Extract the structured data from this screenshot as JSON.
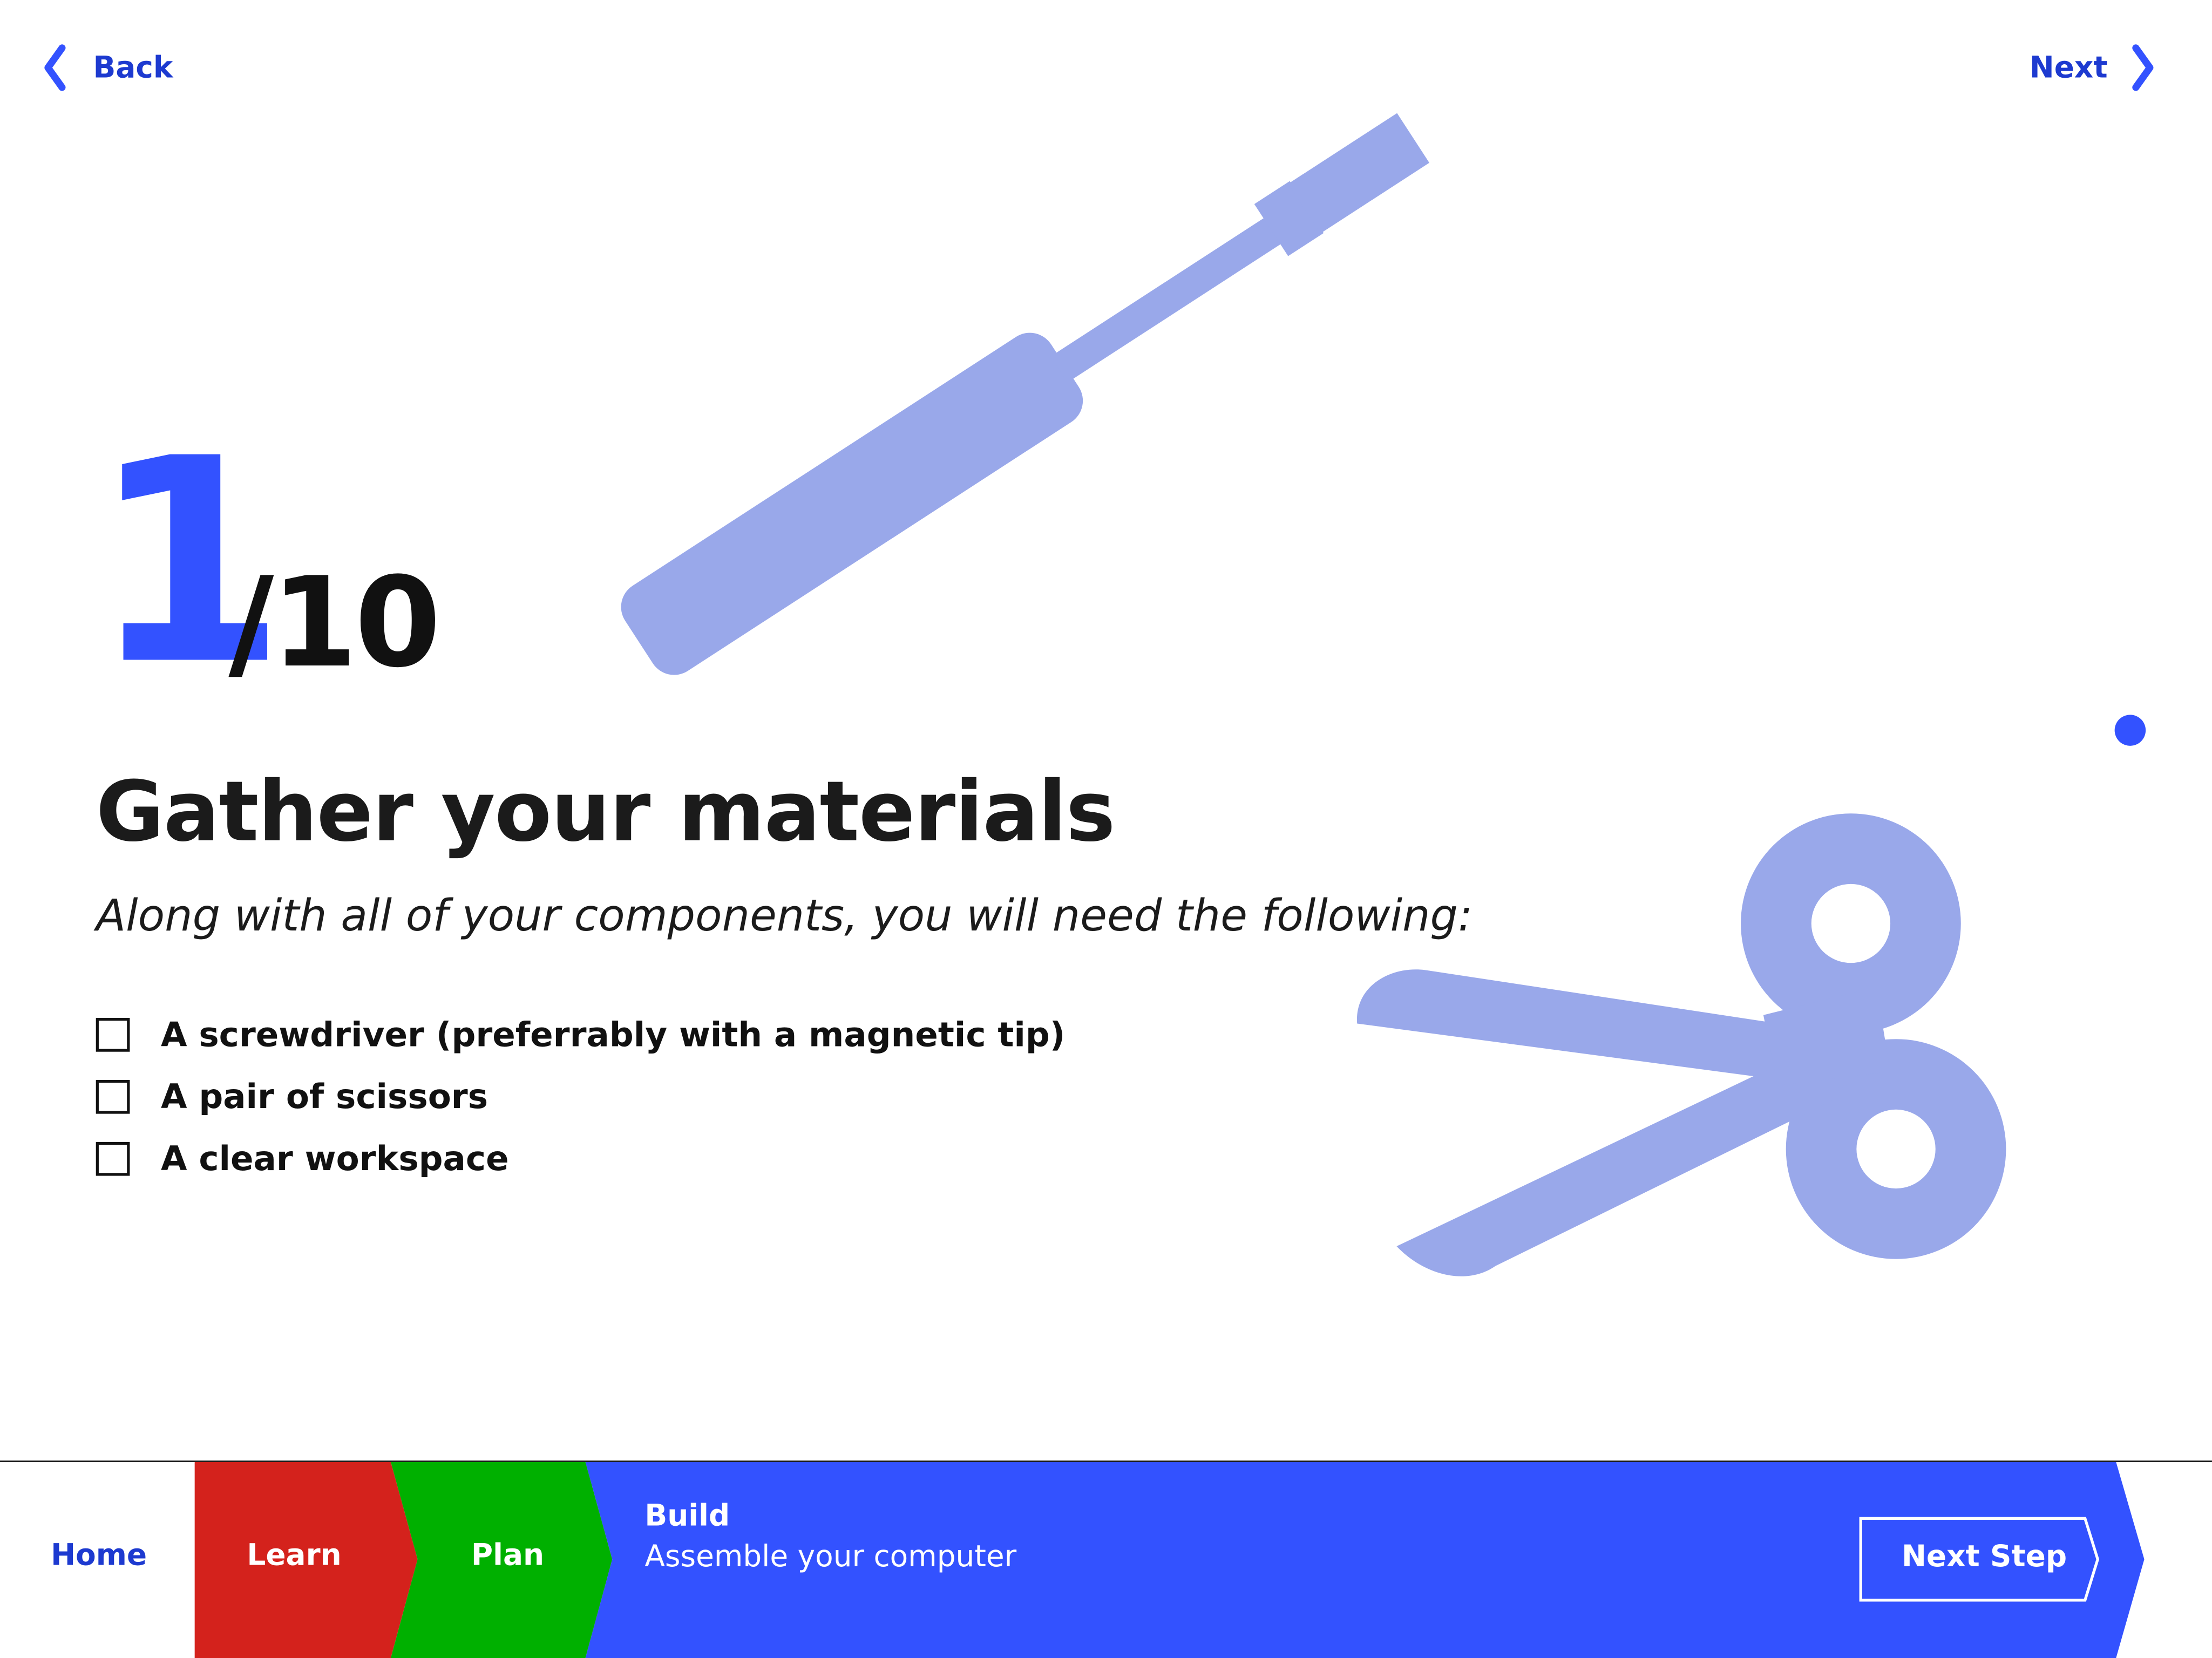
{
  "nav": {
    "back_label": "Back",
    "next_label": "Next"
  },
  "step": {
    "current": "1",
    "total": "/10"
  },
  "content": {
    "heading": "Gather your materials",
    "subheading": "Along with all of your components, you will need the following:",
    "checklist": [
      {
        "label": "A screwdriver (preferrably with a magnetic tip)",
        "checked": false
      },
      {
        "label": "A pair of scissors",
        "checked": false
      },
      {
        "label": "A clear workspace",
        "checked": false
      }
    ]
  },
  "illustrations": {
    "items": [
      "screwdriver-icon",
      "scissors-icon"
    ],
    "color": "#99a8ea"
  },
  "bottom_bar": {
    "home_label": "Home",
    "stages": [
      {
        "label": "Learn",
        "color": "#d4221c"
      },
      {
        "label": "Plan",
        "color": "#00b000"
      },
      {
        "label": "Build",
        "subtitle": "Assemble your computer",
        "color": "#3352ff"
      }
    ],
    "next_step_label": "Next Step"
  },
  "colors": {
    "accent": "#3352ff",
    "nav_text": "#1d3ad0",
    "text": "#1b1b1b"
  }
}
